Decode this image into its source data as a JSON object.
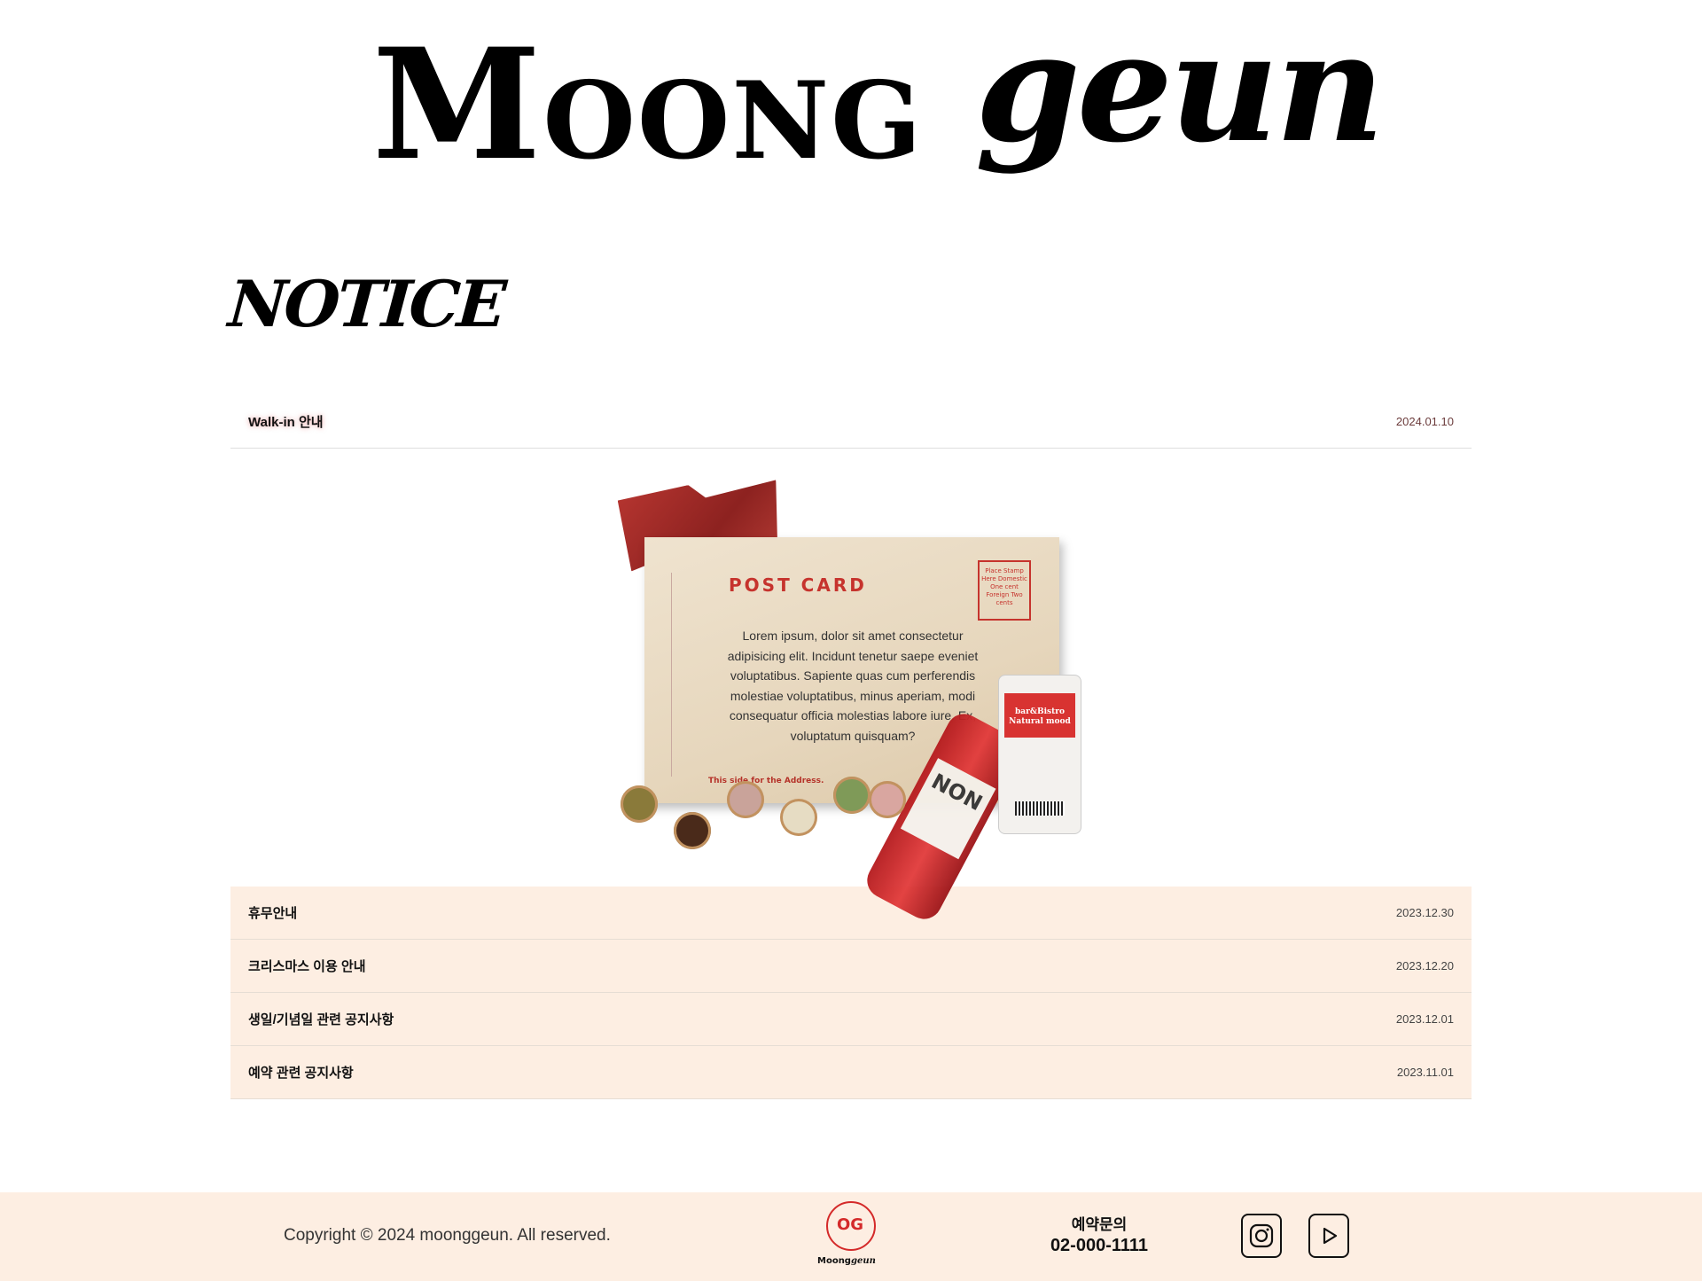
{
  "header": {
    "logo_part1": "Moong",
    "logo_part2": "geun"
  },
  "notice": {
    "title": "NOTICE"
  },
  "posts": [
    {
      "title": "Walk-in 안내",
      "date": "2024.01.10",
      "expanded": true
    },
    {
      "title": "휴무안내",
      "date": "2023.12.30"
    },
    {
      "title": "크리스마스 이용 안내",
      "date": "2023.12.20"
    },
    {
      "title": "생일/기념일 관련 공지사항",
      "date": "2023.12.01"
    },
    {
      "title": "예약 관련 공지사항",
      "date": "2023.11.01"
    }
  ],
  "postcard": {
    "title": "POST CARD",
    "body": "Lorem ipsum, dolor sit amet consectetur adipisicing elit. Incidunt tenetur saepe eveniet voluptatibus. Sapiente quas cum perferendis molestiae voluptatibus, minus aperiam, modi consequatur officia molestias labore iure. Ex, voluptatum quisquam?",
    "stamp": "Place Stamp Here Domestic One cent Foreign Two cents",
    "address_line": "This side for the Address.",
    "ticket_line1": "bar&Bistro",
    "ticket_line2": "Natural mood",
    "bottle_label": "NON"
  },
  "footer": {
    "copyright": "Copyright © 2024 moonggeun. All reserved.",
    "logo_mark": "OG",
    "logo_name1": "Moong",
    "logo_name2": "geun",
    "contact_label": "예약문의",
    "contact_number": "02-000-1111"
  },
  "colors": {
    "accent": "#d42a2a",
    "peach": "#fdeee2"
  }
}
